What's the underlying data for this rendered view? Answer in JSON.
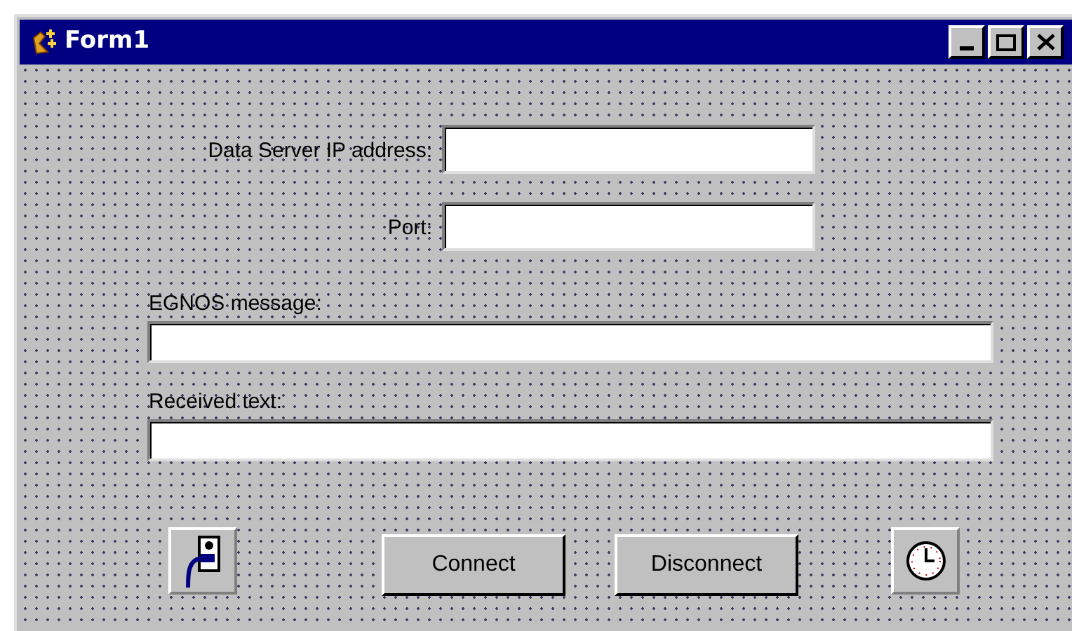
{
  "window": {
    "title": "Form1"
  },
  "fields": [
    {
      "label": "Data Server IP address:",
      "kind": "short"
    },
    {
      "label": "Port:",
      "kind": "short"
    },
    {
      "label": "EGNOS message:",
      "kind": "wide"
    },
    {
      "label": "Received text:",
      "kind": "wide"
    }
  ],
  "toolbar": [
    {
      "kind": "plug"
    },
    {
      "kind": "button",
      "label": "Connect"
    },
    {
      "kind": "button",
      "label": "Disconnect"
    },
    {
      "kind": "clock"
    }
  ]
}
